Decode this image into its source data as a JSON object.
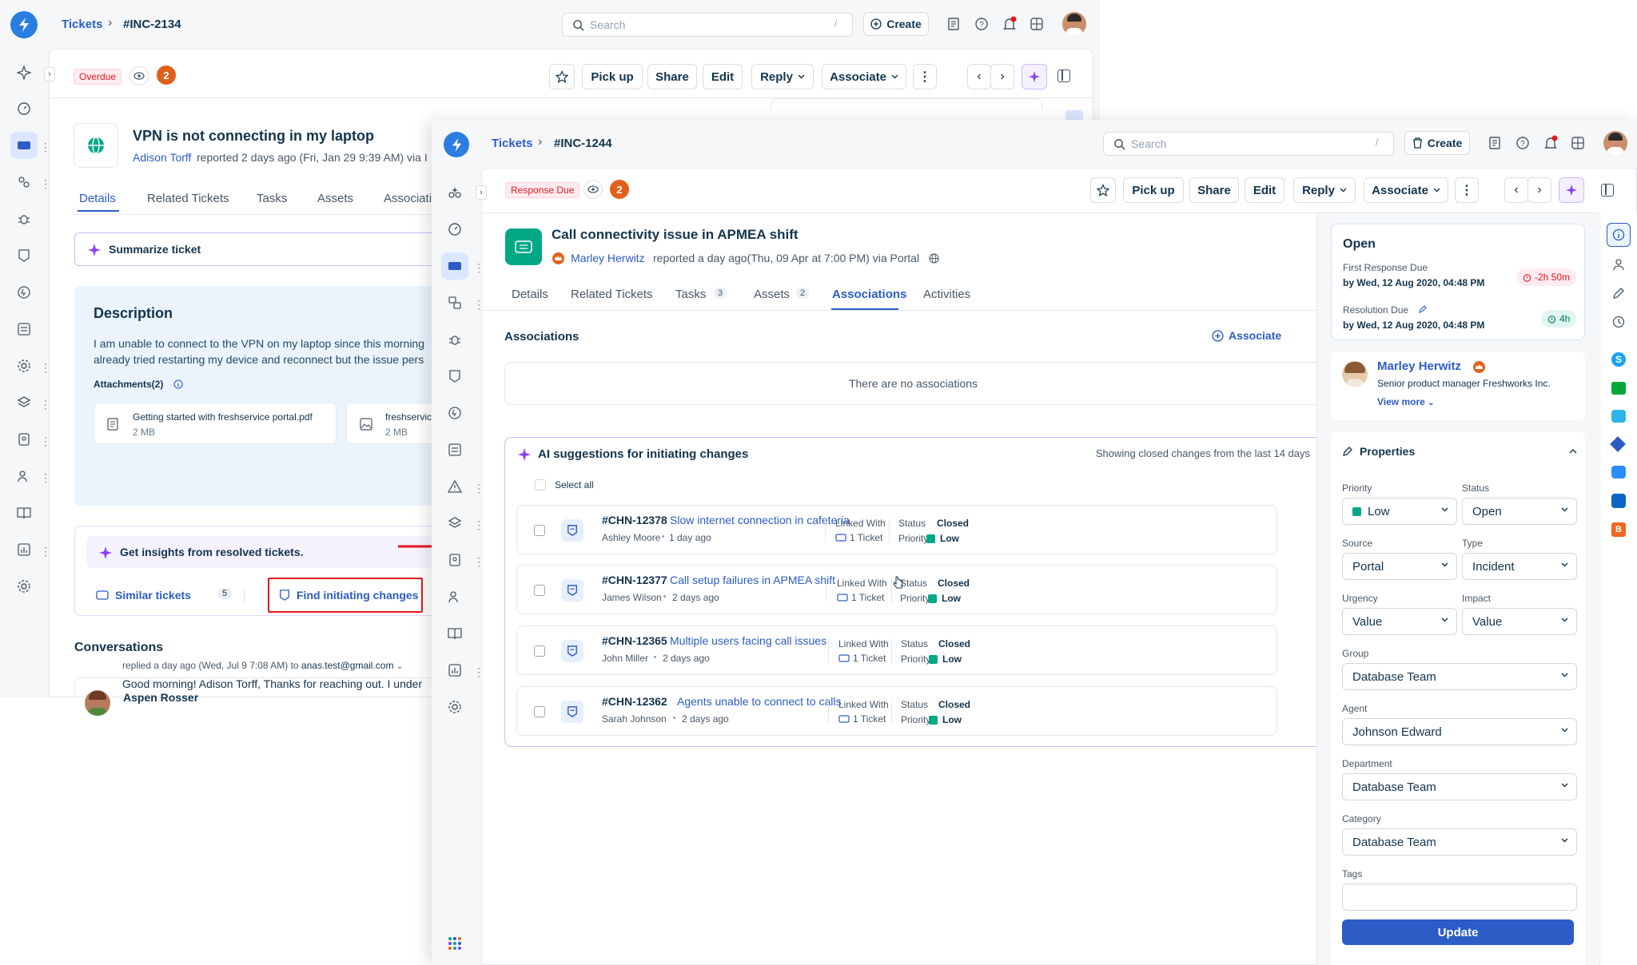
{
  "back": {
    "breadcrumb": {
      "root": "Tickets",
      "id": "#INC-2134"
    },
    "search_placeholder": "Search",
    "search_shortcut": "/",
    "create_label": "Create",
    "status_badge": "Overdue",
    "count_badge": "2",
    "toolbar": {
      "pickup": "Pick up",
      "share": "Share",
      "edit": "Edit",
      "reply": "Reply",
      "associate": "Associate"
    },
    "ticket": {
      "title": "VPN is not connecting in my laptop",
      "requester": "Adison Torff",
      "meta": "reported 2 days ago (Fri, Jan 29 9:39 AM) via I"
    },
    "tabs": [
      "Details",
      "Related Tickets",
      "Tasks",
      "Assets",
      "Associati"
    ],
    "summarize": "Summarize ticket",
    "description": {
      "heading": "Description",
      "line1": "I am unable to connect to the VPN on my laptop since this morning",
      "line2": "already tried restarting my device and reconnect but the issue pers",
      "attachments_label": "Attachments(2)",
      "files": [
        {
          "name": "Getting started with freshservice portal.pdf",
          "size": "2 MB"
        },
        {
          "name": "freshservic",
          "size": "2 MB"
        }
      ]
    },
    "insights": {
      "heading": "Get insights from resolved tickets.",
      "similar": "Similar tickets",
      "similar_count": "5",
      "find": "Find initiating changes"
    },
    "conversations": {
      "heading": "Conversations",
      "author": "Aspen Rosser",
      "meta_prefix": "replied a day ago (Wed, Jul 9 7:08 AM) to",
      "meta_email": "anas.test@gmail.com",
      "body": "Good morning! Adison Torff, Thanks for reaching out. I under"
    }
  },
  "front": {
    "breadcrumb": {
      "root": "Tickets",
      "id": "#INC-1244"
    },
    "search_placeholder": "Search",
    "search_shortcut": "/",
    "create_label": "Create",
    "status_badge": "Response Due",
    "count_badge": "2",
    "toolbar": {
      "pickup": "Pick up",
      "share": "Share",
      "edit": "Edit",
      "reply": "Reply",
      "associate": "Associate"
    },
    "ticket": {
      "title": "Call connectivity issue in APMEA shift",
      "requester": "Marley Herwitz",
      "meta": "reported a day ago(Thu, 09 Apr at 7:00 PM) via Portal"
    },
    "tabs": [
      {
        "label": "Details",
        "count": ""
      },
      {
        "label": "Related Tickets",
        "count": ""
      },
      {
        "label": "Tasks",
        "count": "3"
      },
      {
        "label": "Assets",
        "count": "2"
      },
      {
        "label": "Associations",
        "count": ""
      },
      {
        "label": "Activities",
        "count": ""
      }
    ],
    "associations": {
      "heading": "Associations",
      "associate_label": "Associate",
      "empty": "There are no associations"
    },
    "ai": {
      "heading": "AI suggestions for initiating changes",
      "note": "Showing closed changes from the last 14 days",
      "select_all": "Select all",
      "linked_with_label": "Linked With",
      "linked_value": "1 Ticket",
      "status_label": "Status",
      "priority_label": "Priority",
      "changes": [
        {
          "id": "#CHN-12378",
          "title": "Slow internet connection in cafeteria",
          "author": "Ashley Moore",
          "age": "1 day ago",
          "status": "Closed",
          "priority": "Low"
        },
        {
          "id": "#CHN-12377",
          "title": "Call setup failures in APMEA shift",
          "author": "James Wilson",
          "age": "2 days ago",
          "status": "Closed",
          "priority": "Low"
        },
        {
          "id": "#CHN-12365",
          "title": "Multiple users facing call issues",
          "author": "John Miller",
          "age": "2 days ago",
          "status": "Closed",
          "priority": "Low"
        },
        {
          "id": "#CHN-12362",
          "title": "Agents unable to connect to calls",
          "author": "Sarah Johnson",
          "age": "2 days ago",
          "status": "Closed",
          "priority": "Low"
        }
      ]
    },
    "sla": {
      "status": "Open",
      "first_response_label": "First Response Due",
      "first_response_value": "by Wed, 12 Aug 2020, 04:48 PM",
      "first_response_timer": "-2h 50m",
      "resolution_label": "Resolution Due",
      "resolution_value": "by Wed, 12 Aug 2020, 04:48 PM",
      "resolution_timer": "4h"
    },
    "requester_card": {
      "name": "Marley Herwitz",
      "role": "Senior product manager Freshworks Inc.",
      "view_more": "View more"
    },
    "properties": {
      "heading": "Properties",
      "priority_label": "Priority",
      "priority_value": "Low",
      "status_label": "Status",
      "status_value": "Open",
      "source_label": "Source",
      "source_value": "Portal",
      "type_label": "Type",
      "type_value": "Incident",
      "urgency_label": "Urgency",
      "urgency_value": "Value",
      "impact_label": "Impact",
      "impact_value": "Value",
      "group_label": "Group",
      "group_value": "Database Team",
      "agent_label": "Agent",
      "agent_value": "Johnson Edward",
      "department_label": "Department",
      "department_value": "Database Team",
      "category_label": "Category",
      "category_value": "Database Team",
      "tags_label": "Tags",
      "tags_value": "",
      "update_label": "Update"
    }
  },
  "colors": {
    "brand": "#2c5cc5",
    "danger": "#e5171d",
    "success": "#00a886",
    "ai": "#8a3ffc"
  }
}
